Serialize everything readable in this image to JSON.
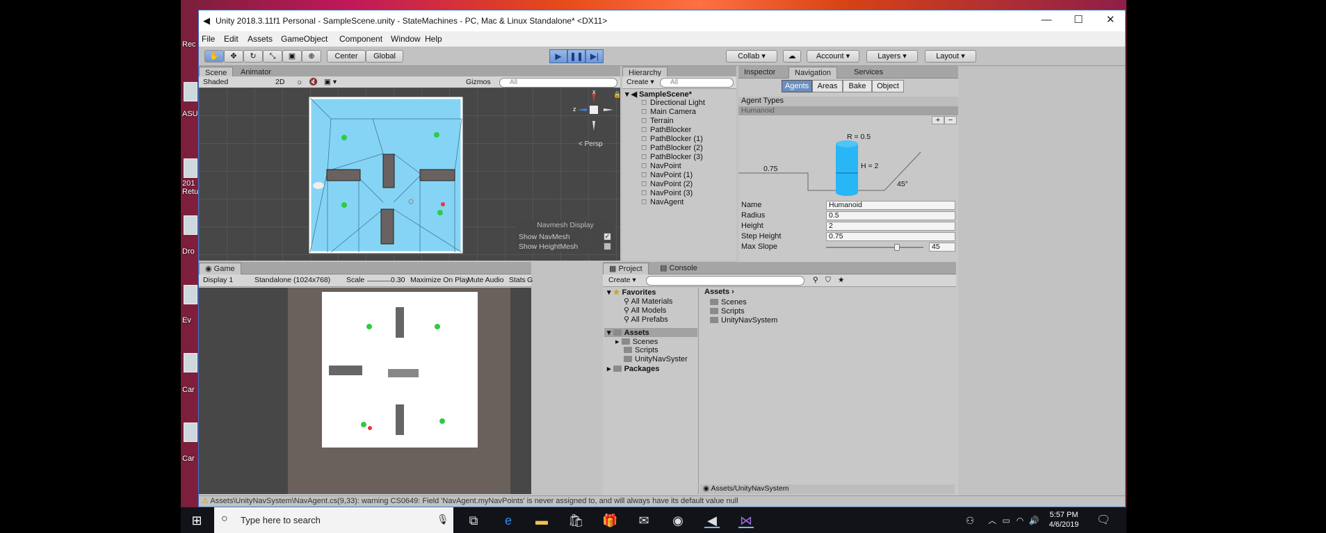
{
  "desktop": {
    "icon_labels": [
      "Rec",
      "ASU",
      "201\nRetu",
      "Dro",
      "Ev",
      "Car",
      "Car"
    ]
  },
  "window": {
    "title": "Unity 2018.3.11f1 Personal - SampleScene.unity - StateMachines - PC, Mac & Linux Standalone* <DX11>",
    "minimize": "—",
    "maximize": "☐",
    "close": "✕"
  },
  "menu": [
    "File",
    "Edit",
    "Assets",
    "GameObject",
    "Component",
    "Window",
    "Help"
  ],
  "toolbar": {
    "pivot": "Center",
    "space": "Global",
    "collab": "Collab ▾",
    "account": "Account",
    "layers": "Layers",
    "layout": "Layout"
  },
  "scene": {
    "tabs": [
      "Scene",
      "Animator"
    ],
    "shading": "Shaded",
    "mode_2d": "2D",
    "gizmos": "Gizmos",
    "search_placeholder": "All",
    "persp": "Persp",
    "axis_x": "x",
    "axis_z": "z",
    "navmesh_panel_title": "Navmesh Display",
    "show_navmesh": "Show NavMesh",
    "show_heightmesh": "Show HeightMesh"
  },
  "hierarchy": {
    "tab": "Hierarchy",
    "create": "Create ▾",
    "search_placeholder": "All",
    "scene_name": "SampleScene*",
    "items": [
      "Directional Light",
      "Main Camera",
      "Terrain",
      "PathBlocker",
      "PathBlocker (1)",
      "PathBlocker (2)",
      "PathBlocker (3)",
      "NavPoint",
      "NavPoint (1)",
      "NavPoint (2)",
      "NavPoint (3)",
      "NavAgent"
    ]
  },
  "inspector": {
    "tabs": [
      "Inspector",
      "Navigation",
      "Services"
    ],
    "nav_tabs": [
      "Agents",
      "Areas",
      "Bake",
      "Object"
    ],
    "agent_types_label": "Agent Types",
    "selected_agent": "Humanoid",
    "diagram": {
      "r_label": "R = 0.5",
      "h_label": "H = 2",
      "step_label": "0.75",
      "slope_label": "45°"
    },
    "fields": [
      {
        "label": "Name",
        "value": "Humanoid"
      },
      {
        "label": "Radius",
        "value": "0.5"
      },
      {
        "label": "Height",
        "value": "2"
      },
      {
        "label": "Step Height",
        "value": "0.75"
      },
      {
        "label": "Max Slope",
        "value": "45"
      }
    ],
    "max_slope_fraction": 0.74,
    "plus": "+",
    "minus": "−"
  },
  "game": {
    "tab": "Game",
    "display": "Display 1",
    "resolution": "Standalone (1024x768)",
    "scale_label": "Scale",
    "scale_value": "0.30",
    "maximize": "Maximize On Play",
    "mute": "Mute Audio",
    "stats": "Stats",
    "gizmos": "G"
  },
  "project": {
    "tabs": [
      "Project",
      "Console"
    ],
    "create": "Create ▾",
    "favorites_label": "Favorites",
    "favorites": [
      "All Materials",
      "All Models",
      "All Prefabs"
    ],
    "assets_label": "Assets",
    "assets_tree": [
      "Scenes",
      "Scripts",
      "UnityNavSyster"
    ],
    "packages_label": "Packages",
    "breadcrumb": "Assets",
    "assets_contents": [
      "Scenes",
      "Scripts",
      "UnityNavSystem"
    ],
    "footer_path": "Assets/UnityNavSystem"
  },
  "status": {
    "message": "Assets\\UnityNavSystem\\NavAgent.cs(9,33): warning CS0649: Field 'NavAgent.myNavPoints' is never assigned to, and will always have its default value null"
  },
  "taskbar": {
    "search_placeholder": "Type here to search",
    "time": "5:57 PM",
    "date": "4/6/2019"
  }
}
